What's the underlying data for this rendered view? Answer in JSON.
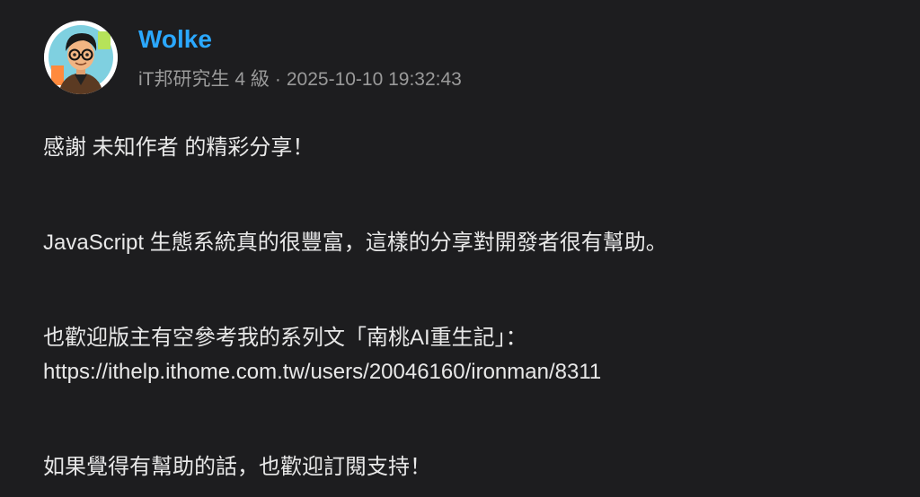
{
  "comment": {
    "author": {
      "name": "Wolke",
      "title": "iT邦研究生",
      "level": "4 級",
      "avatar_icon": "cartoon-avatar-icon"
    },
    "separator": "·",
    "timestamp": "2025-10-10 19:32:43",
    "body": {
      "line1": "感謝 未知作者 的精彩分享！",
      "line2": "JavaScript 生態系統真的很豐富，這樣的分享對開發者很有幫助。",
      "line3": "也歡迎版主有空參考我的系列文「南桃AI重生記」：",
      "link": "https://ithelp.ithome.com.tw/users/20046160/ironman/8311",
      "line4": "如果覺得有幫助的話，也歡迎訂閱支持！"
    }
  },
  "colors": {
    "background": "#1d1d1f",
    "author_name": "#2ba8ff",
    "meta_text": "#9a9a9a",
    "body_text": "#e8e8e8"
  }
}
